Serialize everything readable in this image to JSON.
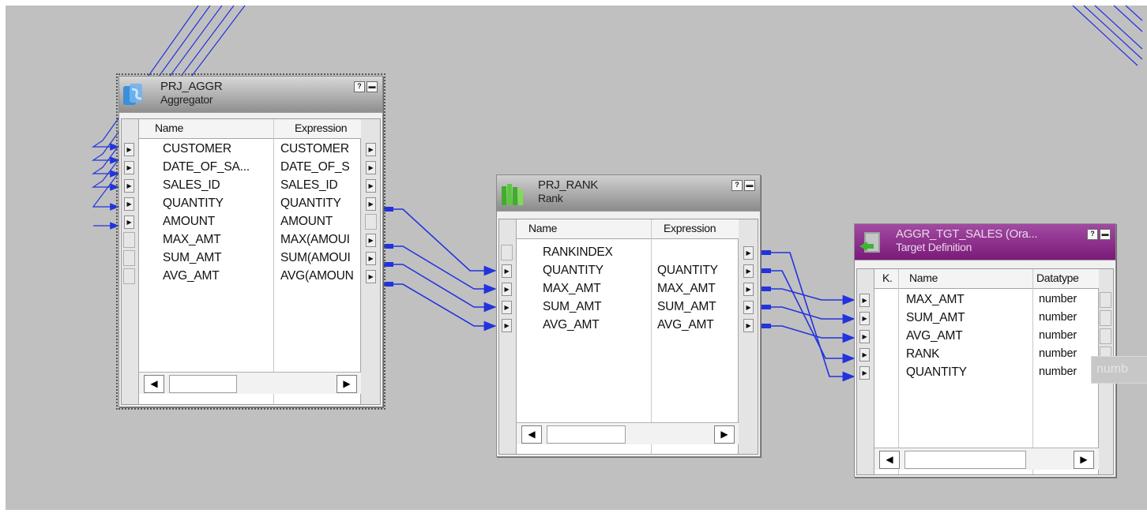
{
  "aggregator": {
    "title": "PRJ_AGGR",
    "subtitle": "Aggregator",
    "help_label": "?",
    "minimize_label": "▬",
    "col_name": "Name",
    "col_expression": "Expression",
    "rows": [
      {
        "name": "CUSTOMER",
        "expr": "CUSTOMER"
      },
      {
        "name": "DATE_OF_SA...",
        "expr": "DATE_OF_S"
      },
      {
        "name": "SALES_ID",
        "expr": "SALES_ID"
      },
      {
        "name": "QUANTITY",
        "expr": "QUANTITY"
      },
      {
        "name": "AMOUNT",
        "expr": "AMOUNT"
      },
      {
        "name": "MAX_AMT",
        "expr": "MAX(AMOUI"
      },
      {
        "name": "SUM_AMT",
        "expr": "SUM(AMOUI"
      },
      {
        "name": "AVG_AMT",
        "expr": "AVG(AMOUN"
      }
    ]
  },
  "rank": {
    "title": "PRJ_RANK",
    "subtitle": "Rank",
    "help_label": "?",
    "minimize_label": "▬",
    "col_name": "Name",
    "col_expression": "Expression",
    "rows": [
      {
        "name": "RANKINDEX",
        "expr": ""
      },
      {
        "name": "QUANTITY",
        "expr": "QUANTITY"
      },
      {
        "name": "MAX_AMT",
        "expr": "MAX_AMT"
      },
      {
        "name": "SUM_AMT",
        "expr": "SUM_AMT"
      },
      {
        "name": "AVG_AMT",
        "expr": "AVG_AMT"
      }
    ]
  },
  "target": {
    "title": "AGGR_TGT_SALES (Ora...",
    "subtitle": "Target Definition",
    "help_label": "?",
    "minimize_label": "▬",
    "col_key": "K.",
    "col_name": "Name",
    "col_datatype": "Datatype",
    "rows": [
      {
        "name": "MAX_AMT",
        "type": "number"
      },
      {
        "name": "SUM_AMT",
        "type": "number"
      },
      {
        "name": "AVG_AMT",
        "type": "number"
      },
      {
        "name": "RANK",
        "type": "number"
      },
      {
        "name": "QUANTITY",
        "type": "number"
      }
    ]
  },
  "tooltip": {
    "text": "numb"
  },
  "colors": {
    "link": "#2233dd",
    "canvas": "#c0c0c0",
    "target_header": "#8a1f8a"
  }
}
